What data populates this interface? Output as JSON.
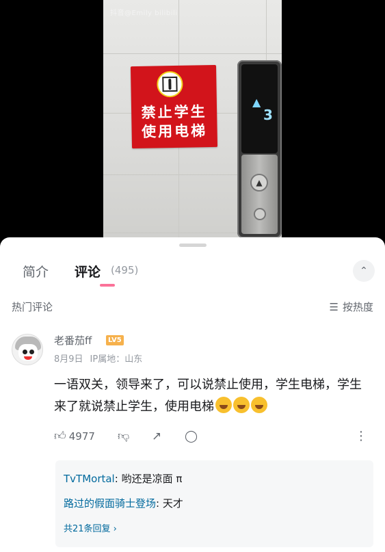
{
  "video": {
    "watermark": "抖音@Emily bilibili",
    "sign_line1": "禁止学生",
    "sign_line2": "使用电梯",
    "floor_number": "3"
  },
  "tabs": {
    "intro": "简介",
    "comments": "评论",
    "comment_count": "(495)"
  },
  "section": {
    "hot_label": "热门评论",
    "sort_label": "按热度"
  },
  "comment": {
    "username": "老番茄ff",
    "level": "LV5",
    "date": "8月9日",
    "ip": "IP属地：山东",
    "text": "一语双关，领导来了，可以说禁止使用，学生电梯，学生来了就说禁止学生，使用电梯",
    "likes": "4977",
    "emoji_count": 3
  },
  "replies": {
    "items": [
      {
        "user": "TvTMortal",
        "text": "哟还是凉面 π"
      },
      {
        "user": "路过的假面骑士登场",
        "text": "天才"
      }
    ],
    "view_all": "共21条回复 ›"
  },
  "colors": {
    "accent_pink": "#fb7299",
    "link_blue": "#00699d",
    "sign_red": "#d2141b",
    "level_badge": "#f6b14c"
  },
  "icons": [
    "thumb-up-icon",
    "thumb-down-icon",
    "share-icon",
    "comment-icon",
    "more-icon",
    "expand-icon",
    "sort-icon"
  ]
}
